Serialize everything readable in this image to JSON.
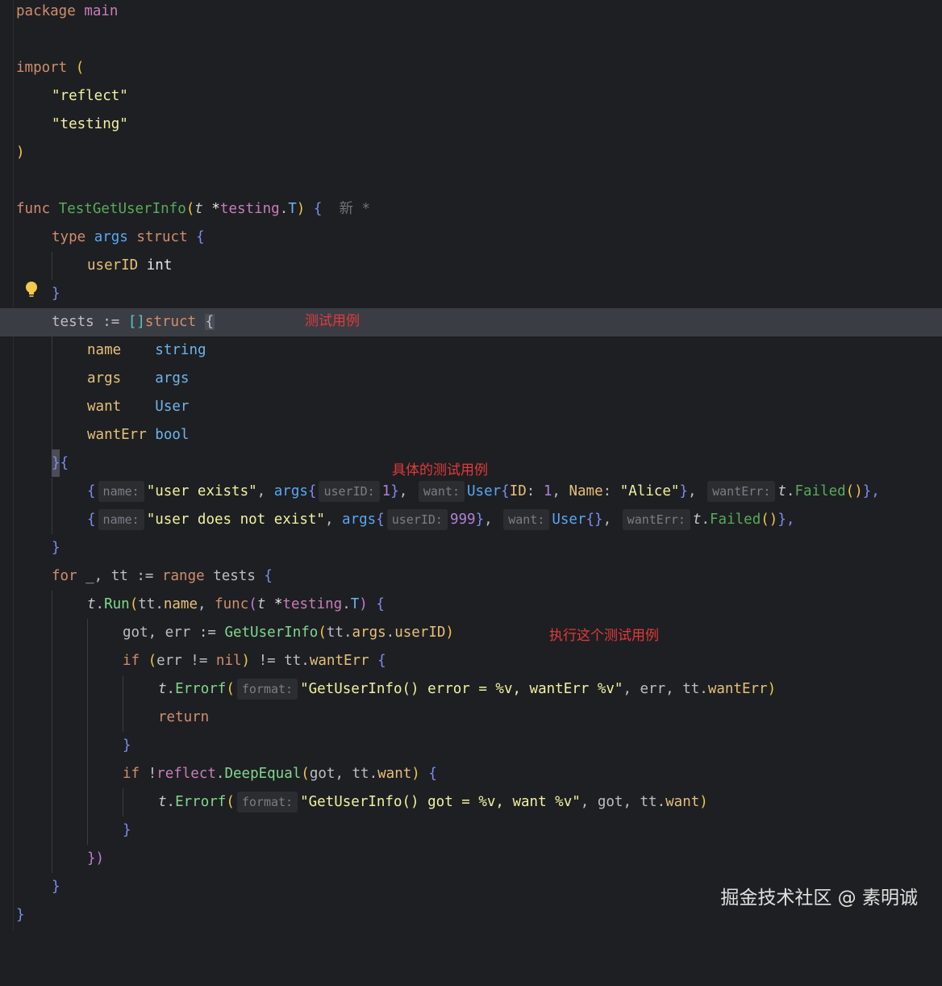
{
  "annotations": {
    "test_cases": "测试用例",
    "specific_cases": "具体的测试用例",
    "run_case": "执行这个测试用例"
  },
  "watermark": "掘金技术社区 @ 素明诚",
  "inlay": {
    "new_label": "新 *"
  },
  "hints": {
    "name": "name:",
    "userID": "userID:",
    "want": "want:",
    "wantErr": "wantErr:",
    "format": "format:"
  },
  "code": {
    "l1_package": "package",
    "l1_main": "main",
    "l3_import": "import",
    "l3_paren": "(",
    "l4_reflect": "\"reflect\"",
    "l5_testing": "\"testing\"",
    "l6_paren": ")",
    "l8_func": "func",
    "l8_name": "TestGetUserInfo",
    "l8_open": "(",
    "l8_t": "t",
    "l8_star": " *",
    "l8_pkg": "testing",
    "l8_dot": ".",
    "l8_T": "T",
    "l8_close": ")",
    "l8_brace": " {",
    "l9_type": "type",
    "l9_args": "args",
    "l9_struct": "struct",
    "l9_brace": " {",
    "l10_field": "userID",
    "l10_type": " int",
    "l11_brace": "}",
    "l12_tests": "tests := ",
    "l12_brackets": "[]",
    "l12_struct": "struct",
    "l12_brace": "{",
    "l13_f": "name",
    "l13_t": "    string",
    "l14_f": "args",
    "l14_t": "    args",
    "l15_f": "want",
    "l15_t": "    User",
    "l16_f": "wantErr",
    "l16_t": " bool",
    "l17_close": "}",
    "l17_open": "{",
    "l18_open": "{",
    "l18_str": "\"user exists\"",
    "l18_comma1": ", ",
    "l18_args": "args",
    "l18_b1": "{",
    "l18_num": "1",
    "l18_b2": "}",
    "l18_comma2": ", ",
    "l18_user": "User",
    "l18_b3": "{",
    "l18_id": "ID",
    "l18_colon1": ": ",
    "l18_num2": "1",
    "l18_comma3": ", ",
    "l18_namef": "Name",
    "l18_colon2": ": ",
    "l18_alice": "\"Alice\"",
    "l18_b4": "}",
    "l18_comma4": ", ",
    "l18_t": "t",
    "l18_dot": ".",
    "l18_failed": "Failed",
    "l18_call": "()",
    "l18_end": "},",
    "l19_open": "{",
    "l19_str": "\"user does not exist\"",
    "l19_comma1": ", ",
    "l19_args": "args",
    "l19_b1": "{",
    "l19_num": "999",
    "l19_b2": "}",
    "l19_comma2": ", ",
    "l19_user": "User",
    "l19_b3": "{}",
    "l19_comma3": ", ",
    "l19_t": "t",
    "l19_dot": ".",
    "l19_failed": "Failed",
    "l19_call": "()",
    "l19_end": "},",
    "l20_brace": "}",
    "l21_for": "for",
    "l21_mid": " _, tt := ",
    "l21_range": "range",
    "l21_tests": " tests ",
    "l21_brace": "{",
    "l22_t": "t",
    "l22_dot": ".",
    "l22_run": "Run",
    "l22_open": "(",
    "l22_tt": "tt.",
    "l22_name": "name",
    "l22_comma": ", ",
    "l22_func": "func",
    "l22_open2": "(",
    "l22_param": "t",
    "l22_star": " *",
    "l22_pkg": "testing",
    "l22_dot2": ".",
    "l22_T": "T",
    "l22_close2": ")",
    "l22_brace": " {",
    "l23_vars": "got, err := ",
    "l23_fn": "GetUserInfo",
    "l23_open": "(",
    "l23_tt": "tt.",
    "l23_args": "args",
    "l23_dot": ".",
    "l23_uid": "userID",
    "l23_close": ")",
    "l24_if": "if",
    "l24_open": " (",
    "l24_err": "err != ",
    "l24_nil": "nil",
    "l24_close": ")",
    "l24_ne": " != tt.",
    "l24_wanterr": "wantErr",
    "l24_brace": " {",
    "l25_t": "t",
    "l25_dot": ".",
    "l25_errorf": "Errorf",
    "l25_open": "(",
    "l25_str": "\"GetUserInfo() error = %v, wantErr %v\"",
    "l25_mid": ", err, tt.",
    "l25_wanterr": "wantErr",
    "l25_close": ")",
    "l26_return": "return",
    "l27_brace": "}",
    "l28_if": "if",
    "l28_not": " !",
    "l28_pkg": "reflect",
    "l28_dot": ".",
    "l28_fn": "DeepEqual",
    "l28_open": "(",
    "l28_mid": "got, tt.",
    "l28_want": "want",
    "l28_close": ")",
    "l28_brace": " {",
    "l29_t": "t",
    "l29_dot": ".",
    "l29_errorf": "Errorf",
    "l29_open": "(",
    "l29_str": "\"GetUserInfo() got = %v, want %v\"",
    "l29_mid": ", got, tt.",
    "l29_want": "want",
    "l29_close": ")",
    "l30_brace": "}",
    "l31_close": "})",
    "l32_brace": "}",
    "l33_brace": "}"
  }
}
